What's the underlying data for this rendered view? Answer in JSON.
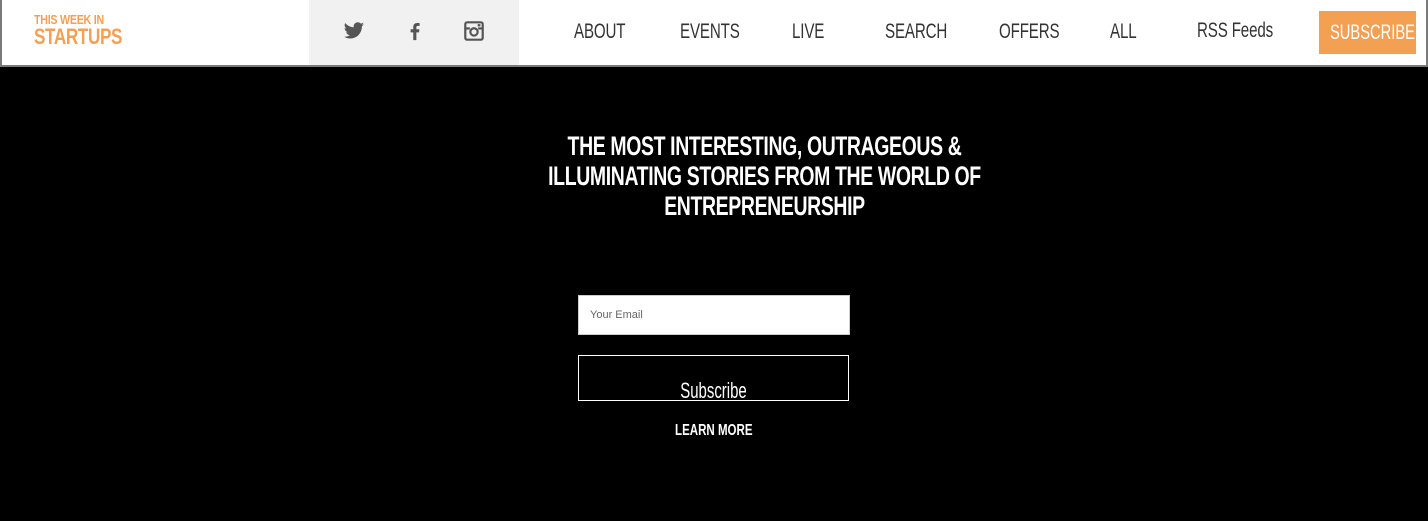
{
  "brand": {
    "line1": "THIS WEEK IN",
    "line2": "STARTUPS",
    "color": "#f4a053"
  },
  "social": [
    {
      "icon": "twitter-icon"
    },
    {
      "icon": "facebook-icon"
    },
    {
      "icon": "instagram-icon"
    }
  ],
  "nav": {
    "items": [
      "ABOUT",
      "EVENTS",
      "LIVE",
      "SEARCH",
      "OFFERS",
      "ALL",
      "RSS Feeds"
    ],
    "subscribe_label": "SUBSCRIBE"
  },
  "hero": {
    "title_line1": "THE MOST INTERESTING, OUTRAGEOUS &",
    "title_line2": "ILLUMINATING STORIES FROM THE WORLD OF",
    "title_line3": "ENTREPRENEURSHIP"
  },
  "form": {
    "email_placeholder": "Your Email",
    "email_value": "",
    "subscribe_label": "Subscribe",
    "learn_more_label": "LEARN MORE"
  },
  "colors": {
    "accent": "#f4a053",
    "background": "#000000",
    "header_bg": "#ffffff",
    "social_bg": "#f1f1f1"
  }
}
